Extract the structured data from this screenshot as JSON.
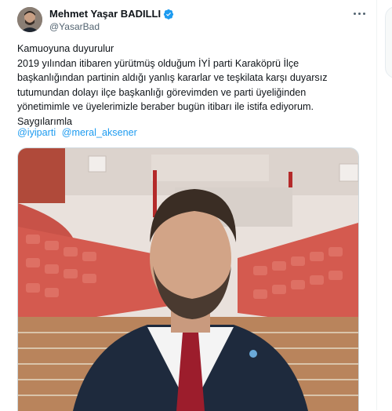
{
  "author": {
    "display_name": "Mehmet Yaşar BADILLI",
    "handle": "@YasarBad",
    "verified": true
  },
  "tweet": {
    "lines": [
      "Kamuoyuna duyurulur",
      "2019 yılından itibaren yürütmüş olduğum İYİ parti Karaköprü İlçe",
      "başkanlığından partinin aldığı yanlış kararlar ve teşkilata karşı duyarsız",
      "tutumundan dolayı ilçe başkanlığı görevimden ve parti üyeliğinden",
      "yönetimimle ve üyelerimizle beraber bugün itibarı ile istifa ediyorum.",
      "Saygılarımla"
    ],
    "mentions": [
      "@iyiparti",
      "@meral_aksener"
    ]
  },
  "colors": {
    "link": "#1d9bf0",
    "verified_badge": "#1d9bf0",
    "secondary_text": "#536471"
  },
  "icons": {
    "verified": "verified-badge-icon",
    "more": "more-options-icon"
  }
}
